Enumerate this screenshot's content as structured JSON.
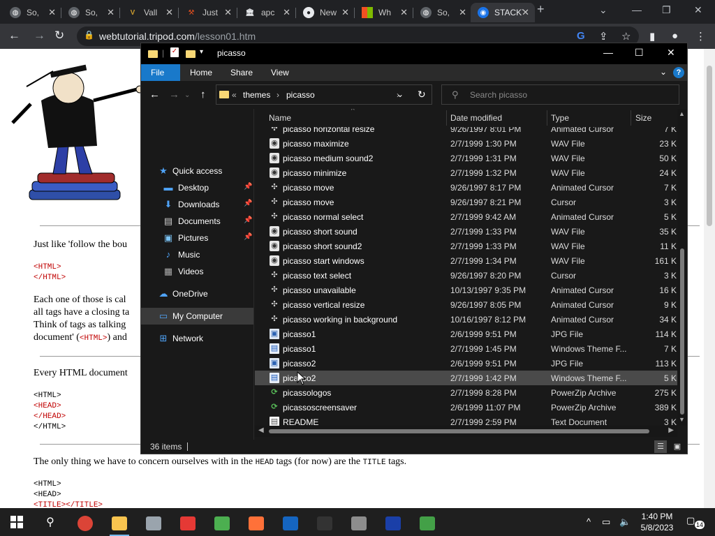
{
  "browser": {
    "tabs": [
      {
        "title": "So,",
        "icon": "globe-icon",
        "color": "#9aa0a6"
      },
      {
        "title": "So,",
        "icon": "globe-icon",
        "color": "#9aa0a6"
      },
      {
        "title": "Vall",
        "icon": "v-logo-icon",
        "color": "#c99a2e"
      },
      {
        "title": "Just",
        "icon": "hammer-icon",
        "color": "#e8501e"
      },
      {
        "title": "apc",
        "icon": "museum-icon",
        "color": "#e8eaed"
      },
      {
        "title": "New",
        "icon": "github-icon",
        "color": "#e8eaed"
      },
      {
        "title": "Wh",
        "icon": "microsoft-icon",
        "color": "#f25022"
      },
      {
        "title": "So,",
        "icon": "globe-icon",
        "color": "#9aa0a6"
      },
      {
        "title": "STACKT",
        "icon": "stack-icon",
        "color": "#1a73e8"
      }
    ],
    "url_host": "webtutorial.tripod.com",
    "url_path": "/lesson01.htm"
  },
  "webpage": {
    "p1": "Just like 'follow the bou",
    "c1a": "<HTML>",
    "c1b": "</HTML>",
    "p2a": "Each one of those is cal",
    "p2b": "all tags have a closing ta",
    "p2c": "Think of tags as talking",
    "p2d_pre": "document' (",
    "p2d_code": "<HTML>",
    "p2d_post": ") and",
    "p3": "Every HTML document",
    "c2a": "<HTML>",
    "c2b": "<HEAD>",
    "c2c": "</HEAD>",
    "c2d": "</HTML>",
    "p4_pre": "The only thing we have to concern ourselves with in the ",
    "p4_head": "HEAD",
    "p4_mid": " tags (for now) are the ",
    "p4_title": "TITLE",
    "p4_post": " tags.",
    "c3a": "<HTML>",
    "c3b": "<HEAD>",
    "c3c": "<TITLE></TITLE>"
  },
  "explorer": {
    "title": "picasso",
    "ribbon": {
      "file": "File",
      "home": "Home",
      "share": "Share",
      "view": "View"
    },
    "breadcrumb": {
      "chevrons": "«",
      "themes": "themes",
      "picasso": "picasso"
    },
    "search_placeholder": "Search picasso",
    "nav": {
      "quick_access": "Quick access",
      "desktop": "Desktop",
      "downloads": "Downloads",
      "documents": "Documents",
      "pictures": "Pictures",
      "music": "Music",
      "videos": "Videos",
      "onedrive": "OneDrive",
      "my_computer": "My Computer",
      "network": "Network"
    },
    "columns": {
      "name": "Name",
      "date": "Date modified",
      "type": "Type",
      "size": "Size"
    },
    "files": [
      {
        "name": "picasso horizontal resize",
        "date": "9/26/1997 8:01 PM",
        "type": "Animated Cursor",
        "size": "7 K",
        "icon": "cur"
      },
      {
        "name": "picasso maximize",
        "date": "2/7/1999 1:30 PM",
        "type": "WAV File",
        "size": "23 K",
        "icon": "wav"
      },
      {
        "name": "picasso medium sound2",
        "date": "2/7/1999 1:31 PM",
        "type": "WAV File",
        "size": "50 K",
        "icon": "wav"
      },
      {
        "name": "picasso minimize",
        "date": "2/7/1999 1:32 PM",
        "type": "WAV File",
        "size": "24 K",
        "icon": "wav"
      },
      {
        "name": "picasso move",
        "date": "9/26/1997 8:17 PM",
        "type": "Animated Cursor",
        "size": "7 K",
        "icon": "cur"
      },
      {
        "name": "picasso move",
        "date": "9/26/1997 8:21 PM",
        "type": "Cursor",
        "size": "3 K",
        "icon": "cur"
      },
      {
        "name": "picasso normal select",
        "date": "2/7/1999 9:42 AM",
        "type": "Animated Cursor",
        "size": "5 K",
        "icon": "cur"
      },
      {
        "name": "picasso short sound",
        "date": "2/7/1999 1:33 PM",
        "type": "WAV File",
        "size": "35 K",
        "icon": "wav"
      },
      {
        "name": "picasso short sound2",
        "date": "2/7/1999 1:33 PM",
        "type": "WAV File",
        "size": "11 K",
        "icon": "wav"
      },
      {
        "name": "picasso start windows",
        "date": "2/7/1999 1:34 PM",
        "type": "WAV File",
        "size": "161 K",
        "icon": "wav"
      },
      {
        "name": "picasso text select",
        "date": "9/26/1997 8:20 PM",
        "type": "Cursor",
        "size": "3 K",
        "icon": "cur"
      },
      {
        "name": "picasso unavailable",
        "date": "10/13/1997 9:35 PM",
        "type": "Animated Cursor",
        "size": "16 K",
        "icon": "cur"
      },
      {
        "name": "picasso vertical resize",
        "date": "9/26/1997 8:05 PM",
        "type": "Animated Cursor",
        "size": "9 K",
        "icon": "cur"
      },
      {
        "name": "picasso working in background",
        "date": "10/16/1997 8:12 PM",
        "type": "Animated Cursor",
        "size": "34 K",
        "icon": "cur"
      },
      {
        "name": "picasso1",
        "date": "2/6/1999 9:51 PM",
        "type": "JPG File",
        "size": "114 K",
        "icon": "jpg"
      },
      {
        "name": "picasso1",
        "date": "2/7/1999 1:45 PM",
        "type": "Windows Theme F...",
        "size": "7 K",
        "icon": "theme"
      },
      {
        "name": "picasso2",
        "date": "2/6/1999 9:51 PM",
        "type": "JPG File",
        "size": "113 K",
        "icon": "jpg"
      },
      {
        "name": "picasso2",
        "date": "2/7/1999 1:42 PM",
        "type": "Windows Theme F...",
        "size": "5 K",
        "icon": "theme",
        "hover": true
      },
      {
        "name": "picassologos",
        "date": "2/7/1999 8:28 PM",
        "type": "PowerZip Archive",
        "size": "275 K",
        "icon": "zip"
      },
      {
        "name": "picassoscreensaver",
        "date": "2/6/1999 11:07 PM",
        "type": "PowerZip Archive",
        "size": "389 K",
        "icon": "zip"
      },
      {
        "name": "README",
        "date": "2/7/1999 2:59 PM",
        "type": "Text Document",
        "size": "3 K",
        "icon": "txt"
      }
    ],
    "status_count": "36 items"
  },
  "taskbar": {
    "time": "1:40 PM",
    "date": "5/8/2023",
    "notification_count": "14",
    "apps": [
      {
        "name": "chrome-app",
        "color": "#db4437"
      },
      {
        "name": "file-explorer-app",
        "color": "#f8c44f",
        "active": true
      },
      {
        "name": "disk-app",
        "color": "#9aa4ad"
      },
      {
        "name": "paper-plane-app",
        "color": "#e53935"
      },
      {
        "name": "notepad-app",
        "color": "#4caf50"
      },
      {
        "name": "firefox-app",
        "color": "#ff7139"
      },
      {
        "name": "ftp-app",
        "color": "#1565c0"
      },
      {
        "name": "terminal-app",
        "color": "#333333"
      },
      {
        "name": "tools-app",
        "color": "#8d8d8d"
      },
      {
        "name": "blue-app",
        "color": "#1a3fa8"
      },
      {
        "name": "recycle-app",
        "color": "#43a047"
      }
    ]
  }
}
